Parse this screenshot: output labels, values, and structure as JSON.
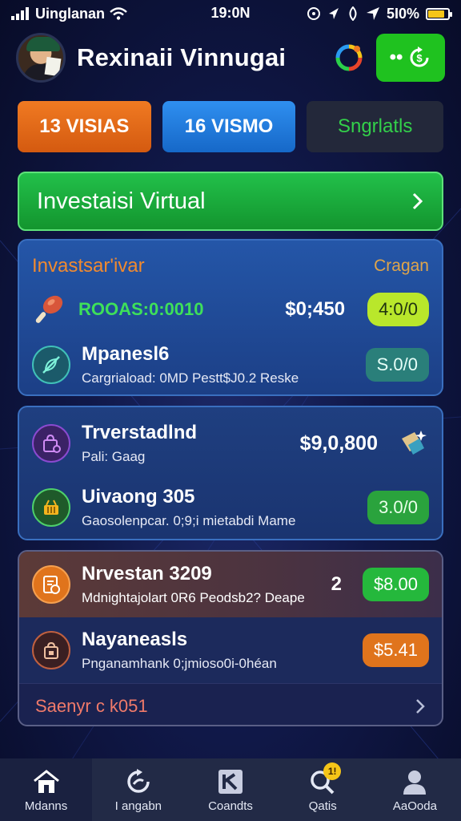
{
  "status_bar": {
    "carrier": "Uinglanan",
    "time": "19:0N",
    "battery": "5I0%",
    "battery_level": 0.85
  },
  "header": {
    "title": "Rexinaii Vinnugai",
    "icons": [
      "avatar",
      "palette-icon",
      "refresh-dollar-icon"
    ],
    "action_label": "••"
  },
  "tabs": [
    {
      "label": "13 VISIAS",
      "color": "#e8681a"
    },
    {
      "label": "16 VISMO",
      "color": "#2383e0"
    },
    {
      "label": "Sngrlatls",
      "color": "#23283a"
    }
  ],
  "banner": {
    "label": "Investaisi Virtual"
  },
  "card1": {
    "header_left": "Invastsar'ivar",
    "header_right": "Cragan",
    "row1": {
      "label": "ROOAS:0:0010",
      "amount": "$0;450",
      "pill": "4:0/0"
    },
    "row2": {
      "title": "Mpanesl6",
      "subtitle": "Cargriaload: 0MD Pestt$J0.2 Reske",
      "pill": "S.0/0"
    }
  },
  "card2": {
    "row1": {
      "title": "Trverstadlnd",
      "subtitle": "Pali: Gaag",
      "amount": "$9,0,800"
    },
    "row2": {
      "title": "Uivaong 305",
      "subtitle": "Gaosolenpcar. 0;9;i mietabdi Mame",
      "pill": "3.0/0"
    }
  },
  "card3": {
    "row1": {
      "title": "Nrvestan 3209",
      "subtitle": "Mdnightajolart 0R6 Peodsb2? Deape",
      "marker": "2",
      "pill": "$8.00"
    },
    "row2": {
      "title": "Nayaneasls",
      "subtitle": "Pnganamhank 0;jmioso0i-0héan",
      "pill": "$5.41"
    },
    "footer": "Saenyr c k051"
  },
  "bottom_nav": [
    {
      "label": "Mdanns",
      "icon": "home-icon",
      "active": true
    },
    {
      "label": "I angabn",
      "icon": "refresh-icon"
    },
    {
      "label": "Coandts",
      "icon": "chart-icon"
    },
    {
      "label": "Qatis",
      "icon": "search-icon",
      "badge": "1!"
    },
    {
      "label": "AaOoda",
      "icon": "user-icon"
    }
  ]
}
